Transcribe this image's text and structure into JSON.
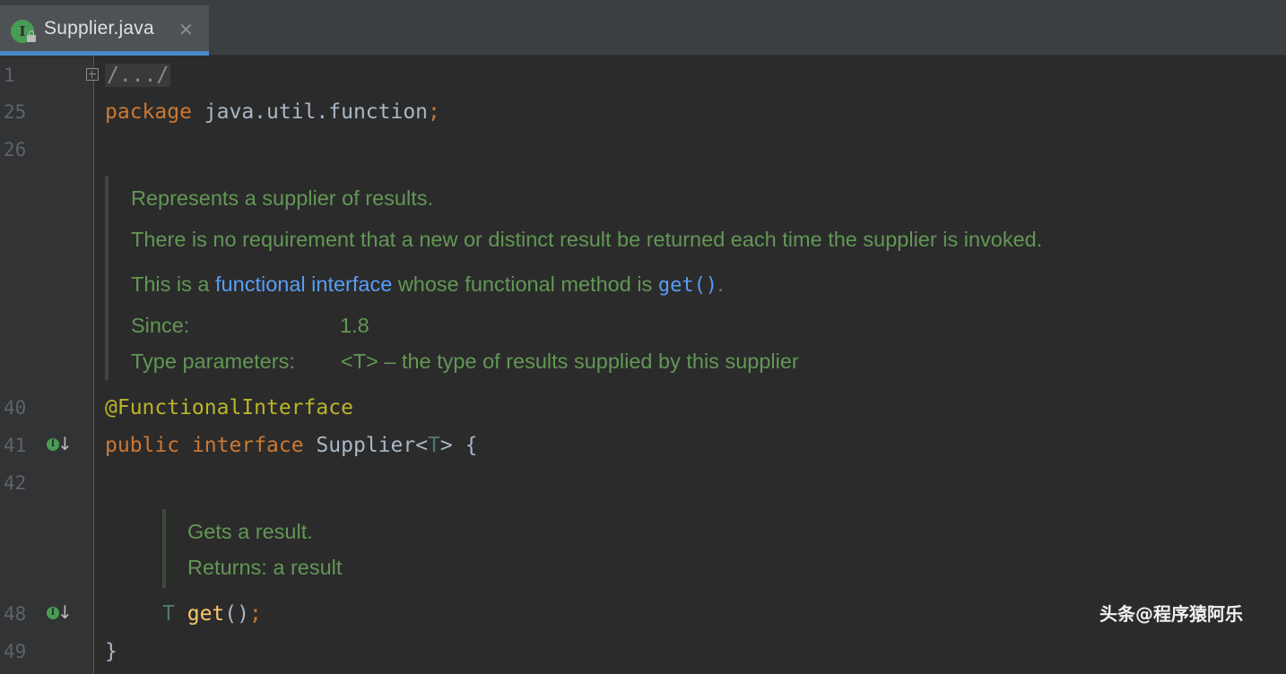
{
  "tab": {
    "icon_letter": "I",
    "filename": "Supplier.java",
    "close_glyph": "✕"
  },
  "gutter": {
    "line_numbers": [
      "1",
      "25",
      "26",
      "40",
      "41",
      "42",
      "48",
      "49"
    ],
    "impl_icon_letter": "I",
    "impl_arrow": "↓"
  },
  "code": {
    "line1_folded": "/.../",
    "line25_keyword": "package",
    "line25_pkg": " java.util.function",
    "line25_semicolon": ";",
    "line40_annotation": "@FunctionalInterface",
    "line41_kw1": "public",
    "line41_kw2": "interface",
    "line41_name": " Supplier<",
    "line41_tparam": "T",
    "line41_rest": "> {",
    "line48_type": "T",
    "line48_method": "get",
    "line48_rest": "()",
    "line48_semicolon": ";",
    "line49_brace": "}"
  },
  "doc1": {
    "line1": "Represents a supplier of results.",
    "line2": "There is no requirement that a new or distinct result be returned each time the supplier is invoked.",
    "line3_pre": "This is a ",
    "line3_link": "functional interface",
    "line3_mid": " whose functional method is ",
    "line3_code": "get()",
    "line3_end": ".",
    "since_label": "Since:",
    "since_value": "1.8",
    "tparams_label": "Type parameters:",
    "tparams_value": "<T> – the type of results supplied by this supplier"
  },
  "doc2": {
    "line1": "Gets a result.",
    "line2": "Returns: a result"
  },
  "watermark": "头条@程序猿阿乐",
  "colors": {
    "editor_bg": "#2b2b2b",
    "keyword": "#cc7832",
    "annotation": "#bbb529",
    "doc_text": "#629755",
    "doc_link": "#589df6",
    "method": "#ffc66d",
    "tab_underline": "#4a88c7"
  }
}
